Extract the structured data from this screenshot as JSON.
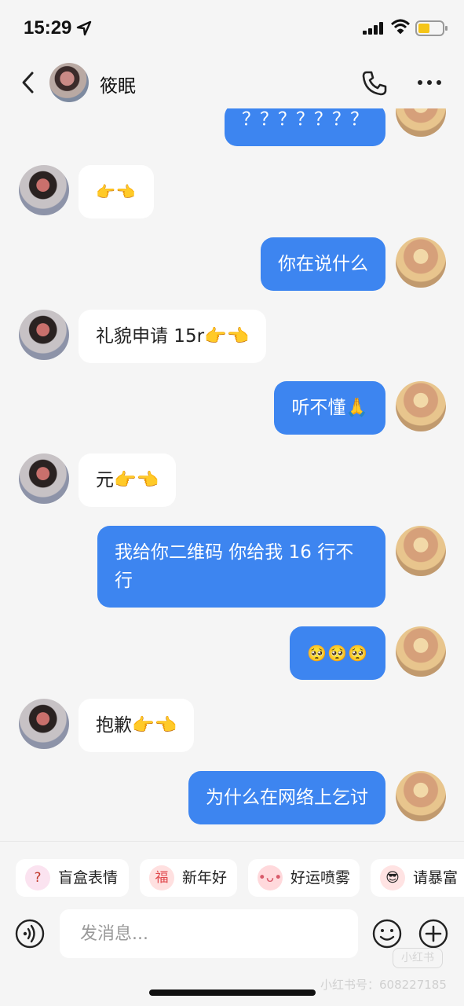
{
  "status_bar": {
    "time": "15:29",
    "icons": [
      "location-arrow-icon",
      "cellular-signal-icon",
      "wifi-icon",
      "battery-icon"
    ],
    "battery_color": "#f5c518"
  },
  "nav": {
    "title": "筱眠",
    "icons": [
      "back-icon",
      "phone-icon",
      "more-icon"
    ]
  },
  "messages": [
    {
      "side": "out",
      "text": "？？？？？？？"
    },
    {
      "side": "in",
      "text": "👉👈"
    },
    {
      "side": "out",
      "text": "你在说什么"
    },
    {
      "side": "in",
      "text": "礼貌申请 15r👉👈"
    },
    {
      "side": "out",
      "text": "听不懂🙏"
    },
    {
      "side": "in",
      "text": "元👉👈"
    },
    {
      "side": "out",
      "text": "我给你二维码 你给我 16 行不行"
    },
    {
      "side": "out",
      "text": "🥺🥺🥺"
    },
    {
      "side": "in",
      "text": "抱歉👉👈"
    },
    {
      "side": "out",
      "text": "为什么在网络上乞讨"
    }
  ],
  "quick_replies": [
    {
      "label": "盲盒表情",
      "icon": "mystery-box-icon"
    },
    {
      "label": "新年好",
      "icon": "new-year-icon"
    },
    {
      "label": "好运喷雾",
      "icon": "lucky-spray-icon"
    },
    {
      "label": "请暴富",
      "icon": "get-rich-icon"
    }
  ],
  "input": {
    "placeholder": "发消息..."
  },
  "colors": {
    "outgoing_bubble": "#3d85f0",
    "incoming_bubble": "#ffffff",
    "background": "#f5f5f5"
  },
  "watermark": {
    "logo": "小红书",
    "text": "小红书号：608227185"
  }
}
